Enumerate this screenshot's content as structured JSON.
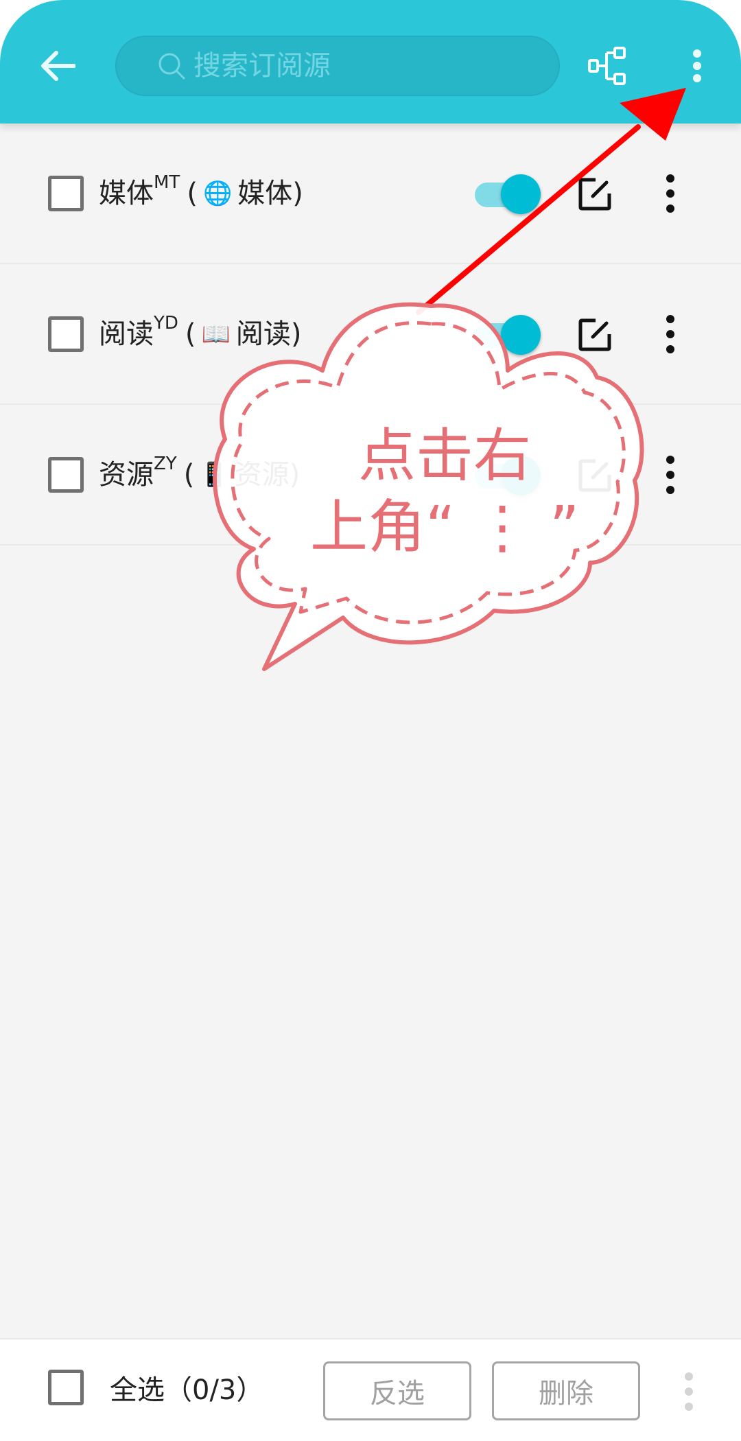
{
  "search": {
    "placeholder": "搜索订阅源"
  },
  "sources": [
    {
      "name": "媒体",
      "sup": "MT",
      "emoji": "🌐",
      "group": "媒体)",
      "enabled": true
    },
    {
      "name": "阅读",
      "sup": "YD",
      "emoji": "📖",
      "group": "阅读)",
      "enabled": true
    },
    {
      "name": "资源",
      "sup": "ZY",
      "emoji": "📱",
      "group": "资源)",
      "enabled": true
    }
  ],
  "bottom": {
    "select_all_label": "全选（0/3）",
    "invert_label": "反选",
    "delete_label": "删除"
  },
  "callout": {
    "line1": "点击右",
    "line2": "上角“ ⋮ ”"
  },
  "colors": {
    "appbar": "#2cc6d9",
    "accent": "#00bcd4",
    "callout": "#e56f74",
    "arrow": "#ff0000"
  }
}
